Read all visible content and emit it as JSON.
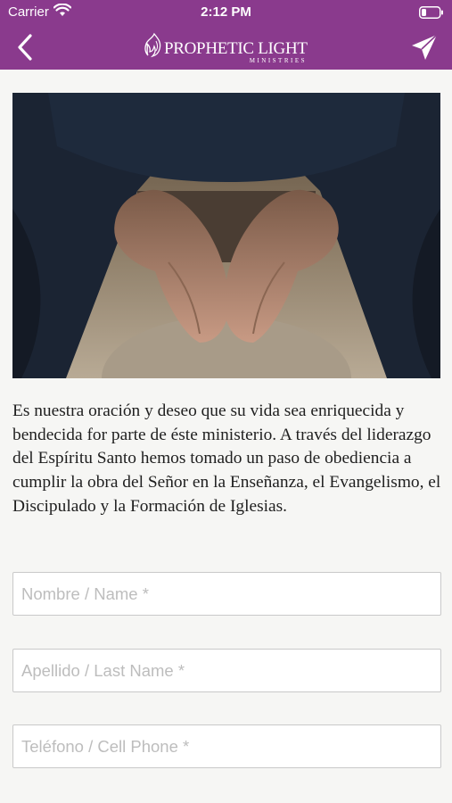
{
  "status_bar": {
    "carrier": "Carrier",
    "time": "2:12 PM"
  },
  "header": {
    "logo_text": "PROPHETIC LIGHT",
    "logo_subtext": "MINISTRIES",
    "back_icon": "chevron-left-icon",
    "send_icon": "paper-plane-icon",
    "bar_color": "#8a3a8d"
  },
  "intro_text": "Es nuestra oración y deseo que su vida sea enriquecida y bendecida for parte de éste ministerio. A través  del liderazgo del Espíritu Santo hemos tomado un paso de obediencia a cumplir la obra del Señor en la Enseñanza, el Evangelismo, el Discipulado y la Formación de Iglesias.",
  "form": {
    "first_name_placeholder": "Nombre / Name *",
    "last_name_placeholder": "Apellido / Last Name *",
    "phone_placeholder": "Teléfono / Cell Phone *"
  }
}
